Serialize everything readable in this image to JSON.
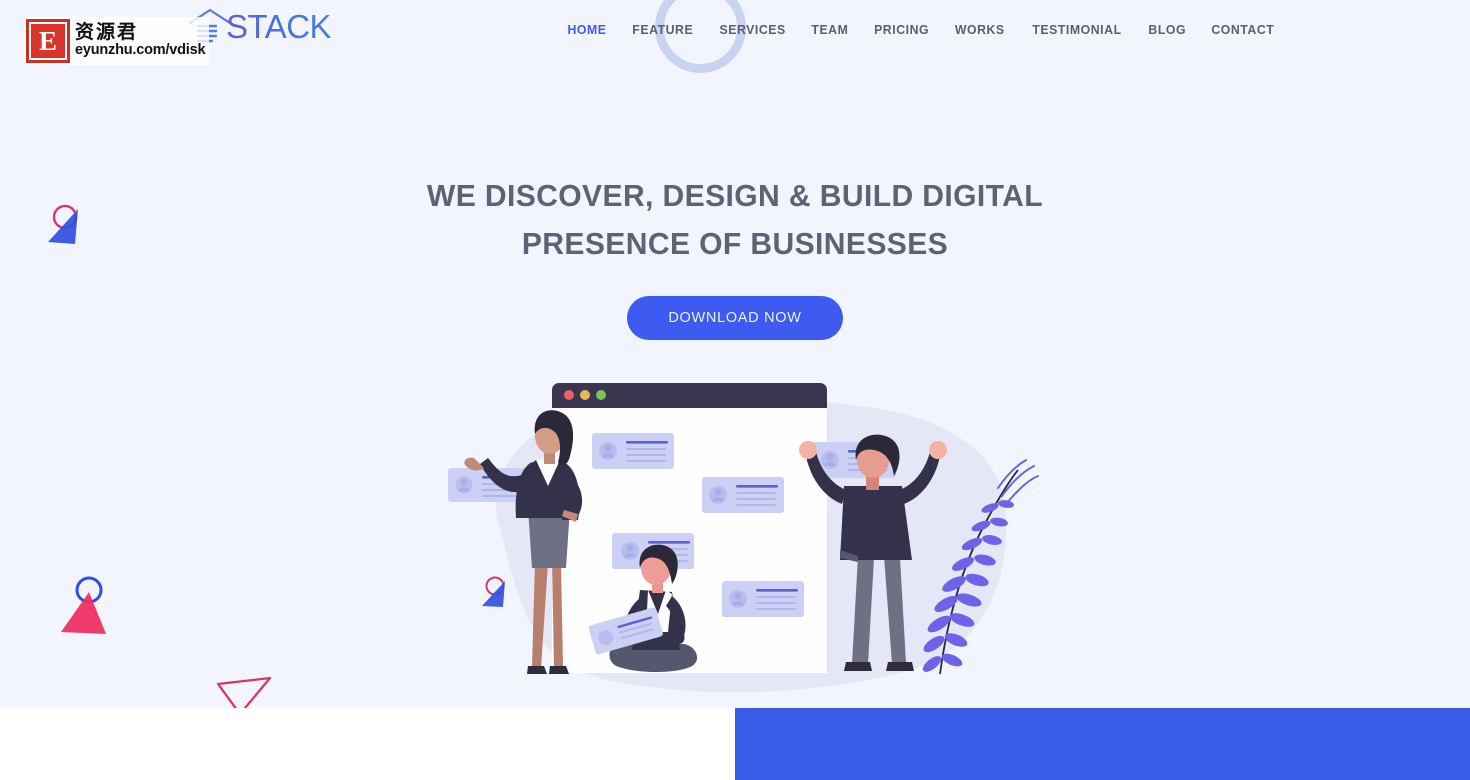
{
  "theme": {
    "hero_bg": "#f2f5fe",
    "accent_blue": "#3d5af1",
    "band_blue": "#3b5ce8",
    "heading_color": "#5d6376",
    "nav_color": "#5a5f70",
    "ring_color": "#c3cbef",
    "card_lavender": "#ccd0f4",
    "fern_purple": "#6c63e8",
    "blob_lavender": "#e3e4f6",
    "window_bar": "#3a3650",
    "dot_red": "#e8635f",
    "dot_yellow": "#e7b84f",
    "dot_green": "#7ec05a",
    "pink": "#ef3d6d",
    "triangle_blue": "#2f4fe0"
  },
  "watermark": {
    "letter": "E",
    "chinese": "资源君",
    "url": "eyunzhu.com/vdisk"
  },
  "brand": {
    "name": "STACK",
    "mark_icon": "stack-layers-icon"
  },
  "nav": {
    "items": [
      {
        "label": "HOME",
        "active": true
      },
      {
        "label": "FEATURE",
        "active": false
      },
      {
        "label": "SERVICES",
        "active": false
      },
      {
        "label": "TEAM",
        "active": false
      },
      {
        "label": "PRICING",
        "active": false
      },
      {
        "label": "WORKS",
        "active": false
      },
      {
        "label": "TESTIMONIAL",
        "active": false
      },
      {
        "label": "BLOG",
        "active": false
      },
      {
        "label": "CONTACT",
        "active": false
      }
    ]
  },
  "hero": {
    "headline_line1": "WE DISCOVER, DESIGN & BUILD DIGITAL",
    "headline_line2": "PRESENCE OF BUSINESSES",
    "cta_label": "DOWNLOAD NOW"
  },
  "illustration": {
    "window": {
      "dots": [
        "red",
        "yellow",
        "green"
      ],
      "card_count": 6
    },
    "figures": [
      "standing-woman",
      "seated-person",
      "standing-man"
    ],
    "plant": "fern-frond"
  },
  "decorations": [
    {
      "name": "triangle-circle-blue-top-left"
    },
    {
      "name": "triangle-circle-pink-left"
    },
    {
      "name": "triangle-outline-pink-bottom"
    },
    {
      "name": "triangle-circle-blue-small"
    }
  ],
  "footer": {
    "left_band_color": "#ffffff",
    "right_band_color": "#3b5ce8"
  }
}
